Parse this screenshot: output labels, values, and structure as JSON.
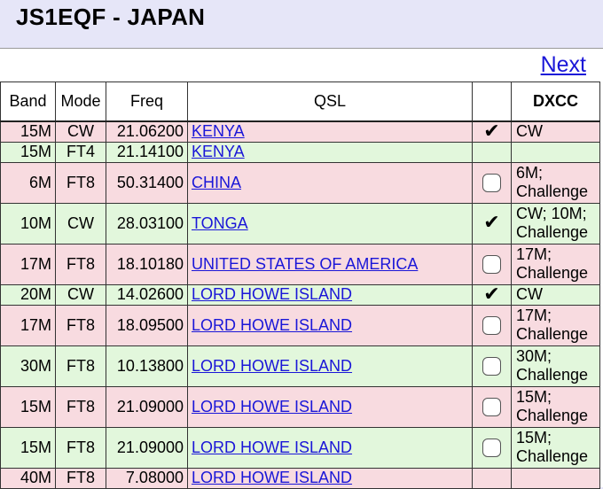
{
  "page": {
    "title": "JS1EQF - JAPAN"
  },
  "nav": {
    "next_label": "Next"
  },
  "colors": {
    "pink_row": "#f8dbe0",
    "green_row": "#e2f7dc",
    "link": "#1a16d8",
    "background": "#e6e6f8"
  },
  "table": {
    "headers": [
      "Band",
      "Mode",
      "Freq",
      "QSL",
      "",
      "DXCC"
    ],
    "rows": [
      {
        "color": "pink",
        "band": "15M",
        "mode": "CW",
        "freq": "21.06200",
        "qsl": "KENYA",
        "check": "checked",
        "dxcc": [
          "CW"
        ]
      },
      {
        "color": "green",
        "band": "15M",
        "mode": "FT4",
        "freq": "21.14100",
        "qsl": "KENYA",
        "check": "none",
        "dxcc": []
      },
      {
        "color": "pink",
        "band": "6M",
        "mode": "FT8",
        "freq": "50.31400",
        "qsl": "CHINA",
        "check": "empty",
        "dxcc": [
          "6M;",
          "Challenge"
        ]
      },
      {
        "color": "green",
        "band": "10M",
        "mode": "CW",
        "freq": "28.03100",
        "qsl": "TONGA",
        "check": "checked",
        "dxcc": [
          "CW; 10M;",
          "Challenge"
        ]
      },
      {
        "color": "pink",
        "band": "17M",
        "mode": "FT8",
        "freq": "18.10180",
        "qsl": "UNITED STATES OF AMERICA",
        "check": "empty",
        "dxcc": [
          "17M;",
          "Challenge"
        ]
      },
      {
        "color": "green",
        "band": "20M",
        "mode": "CW",
        "freq": "14.02600",
        "qsl": "LORD HOWE ISLAND",
        "check": "checked",
        "dxcc": [
          "CW"
        ]
      },
      {
        "color": "pink",
        "band": "17M",
        "mode": "FT8",
        "freq": "18.09500",
        "qsl": "LORD HOWE ISLAND",
        "check": "empty",
        "dxcc": [
          "17M;",
          "Challenge"
        ]
      },
      {
        "color": "green",
        "band": "30M",
        "mode": "FT8",
        "freq": "10.13800",
        "qsl": "LORD HOWE ISLAND",
        "check": "empty",
        "dxcc": [
          "30M;",
          "Challenge"
        ]
      },
      {
        "color": "pink",
        "band": "15M",
        "mode": "FT8",
        "freq": "21.09000",
        "qsl": "LORD HOWE ISLAND",
        "check": "empty",
        "dxcc": [
          "15M;",
          "Challenge"
        ]
      },
      {
        "color": "green",
        "band": "15M",
        "mode": "FT8",
        "freq": "21.09000",
        "qsl": "LORD HOWE ISLAND",
        "check": "empty",
        "dxcc": [
          "15M;",
          "Challenge"
        ]
      },
      {
        "color": "pink",
        "band": "40M",
        "mode": "FT8",
        "freq": "7.08000",
        "qsl": "LORD HOWE ISLAND",
        "check": "none",
        "dxcc": []
      }
    ]
  }
}
